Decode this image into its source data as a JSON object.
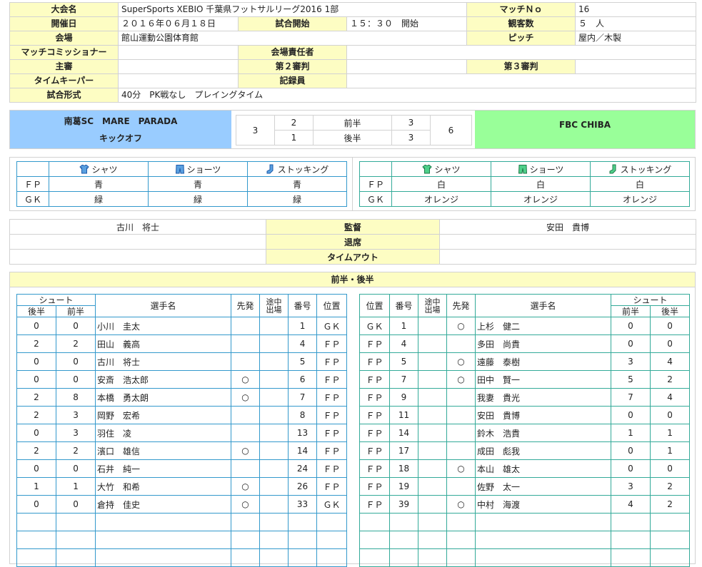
{
  "info": {
    "tournament_label": "大会名",
    "tournament": "SuperSports XEBIO 千葉県フットサルリーグ2016 1部",
    "match_no_label": "マッチＮｏ",
    "match_no": "16",
    "date_label": "開催日",
    "date": "２０１６年０６月１８日",
    "start_label": "試合開始",
    "start": "１５：３０　開始",
    "audience_label": "観客数",
    "audience": "５　人",
    "venue_label": "会場",
    "venue": "館山運動公園体育館",
    "pitch_label": "ピッチ",
    "pitch": "屋内／木製",
    "commissioner_label": "マッチコミッショナー",
    "commissioner": "",
    "venue_manager_label": "会場責任者",
    "venue_manager": "",
    "referee_label": "主審",
    "referee": "",
    "second_ref_label": "第２審判",
    "second_ref": "",
    "third_ref_label": "第３審判",
    "third_ref": "",
    "timekeeper_label": "タイムキーパー",
    "timekeeper": "",
    "recorder_label": "記録員",
    "recorder": "",
    "format_label": "試合形式",
    "format": "40分　PK戦なし　プレイングタイム"
  },
  "score": {
    "home_name": "南葛SC　MARE　PARADA",
    "kickoff": "キックオフ",
    "away_name": "FBC CHIBA",
    "home_total": "3",
    "home_first": "2",
    "home_second": "1",
    "first_label": "前半",
    "second_label": "後半",
    "away_first": "3",
    "away_second": "3",
    "away_total": "6"
  },
  "uniform_headers": {
    "shirt": "シャツ",
    "shorts": "ショーツ",
    "socks": "ストッキング"
  },
  "home_uniform": {
    "fp": {
      "label": "ＦＰ",
      "shirt": "青",
      "shorts": "青",
      "socks": "青"
    },
    "gk": {
      "label": "ＧＫ",
      "shirt": "緑",
      "shorts": "緑",
      "socks": "緑"
    }
  },
  "away_uniform": {
    "fp": {
      "label": "ＦＰ",
      "shirt": "白",
      "shorts": "白",
      "socks": "白"
    },
    "gk": {
      "label": "ＧＫ",
      "shirt": "オレンジ",
      "shorts": "オレンジ",
      "socks": "オレンジ"
    }
  },
  "staff": {
    "home_manager": "古川　将士",
    "manager_label": "監督",
    "away_manager": "安田　貴博",
    "sendoff_label": "退席",
    "timeout_label": "タイムアウト"
  },
  "lineup": {
    "section_title": "前半・後半",
    "h": {
      "shoot": "シュート",
      "second": "後半",
      "first": "前半",
      "name": "選手名",
      "starter": "先発",
      "sub1": "途中",
      "sub2": "出場",
      "number": "番号",
      "position": "位置"
    },
    "home": [
      {
        "s2": "0",
        "s1": "0",
        "name": "小川　圭太",
        "start": "",
        "num": "1",
        "pos": "ＧＫ"
      },
      {
        "s2": "2",
        "s1": "2",
        "name": "田山　義高",
        "start": "",
        "num": "4",
        "pos": "ＦＰ"
      },
      {
        "s2": "0",
        "s1": "0",
        "name": "古川　将士",
        "start": "",
        "num": "5",
        "pos": "ＦＰ"
      },
      {
        "s2": "0",
        "s1": "0",
        "name": "安斎　浩太郎",
        "start": "○",
        "num": "6",
        "pos": "ＦＰ"
      },
      {
        "s2": "2",
        "s1": "8",
        "name": "本橋　勇太朗",
        "start": "○",
        "num": "7",
        "pos": "ＦＰ"
      },
      {
        "s2": "2",
        "s1": "3",
        "name": "岡野　宏希",
        "start": "",
        "num": "8",
        "pos": "ＦＰ"
      },
      {
        "s2": "0",
        "s1": "3",
        "name": "羽住　凌",
        "start": "",
        "num": "13",
        "pos": "ＦＰ"
      },
      {
        "s2": "2",
        "s1": "2",
        "name": "濱口　雄信",
        "start": "○",
        "num": "14",
        "pos": "ＦＰ"
      },
      {
        "s2": "0",
        "s1": "0",
        "name": "石井　純一",
        "start": "",
        "num": "24",
        "pos": "ＦＰ"
      },
      {
        "s2": "1",
        "s1": "1",
        "name": "大竹　和希",
        "start": "○",
        "num": "26",
        "pos": "ＦＰ"
      },
      {
        "s2": "0",
        "s1": "0",
        "name": "倉持　佳史",
        "start": "○",
        "num": "33",
        "pos": "ＧＫ"
      }
    ],
    "away": [
      {
        "pos": "ＧＫ",
        "num": "1",
        "start": "○",
        "name": "上杉　健二",
        "s1": "0",
        "s2": "0"
      },
      {
        "pos": "ＦＰ",
        "num": "4",
        "start": "",
        "name": "多田　尚貴",
        "s1": "0",
        "s2": "0"
      },
      {
        "pos": "ＦＰ",
        "num": "5",
        "start": "○",
        "name": "遠藤　泰樹",
        "s1": "3",
        "s2": "4"
      },
      {
        "pos": "ＦＰ",
        "num": "7",
        "start": "○",
        "name": "田中　賢一",
        "s1": "5",
        "s2": "2"
      },
      {
        "pos": "ＦＰ",
        "num": "9",
        "start": "",
        "name": "我妻　貴光",
        "s1": "7",
        "s2": "4"
      },
      {
        "pos": "ＦＰ",
        "num": "11",
        "start": "",
        "name": "安田　貴博",
        "s1": "0",
        "s2": "0"
      },
      {
        "pos": "ＦＰ",
        "num": "14",
        "start": "",
        "name": "鈴木　浩貴",
        "s1": "1",
        "s2": "1"
      },
      {
        "pos": "ＦＰ",
        "num": "17",
        "start": "",
        "name": "成田　彪我",
        "s1": "0",
        "s2": "1"
      },
      {
        "pos": "ＦＰ",
        "num": "18",
        "start": "○",
        "name": "本山　雄太",
        "s1": "0",
        "s2": "0"
      },
      {
        "pos": "ＦＰ",
        "num": "19",
        "start": "",
        "name": "佐野　太一",
        "s1": "3",
        "s2": "2"
      },
      {
        "pos": "ＦＰ",
        "num": "39",
        "start": "○",
        "name": "中村　海渡",
        "s1": "4",
        "s2": "2"
      }
    ]
  },
  "colors": {
    "label_bg": "#fdfdc3",
    "home_bg": "#99ccff",
    "away_bg": "#99ff99",
    "home_border": "#3399cc",
    "away_border": "#33aa99"
  },
  "icons": [
    "shirt-icon",
    "shorts-icon",
    "socks-icon"
  ]
}
